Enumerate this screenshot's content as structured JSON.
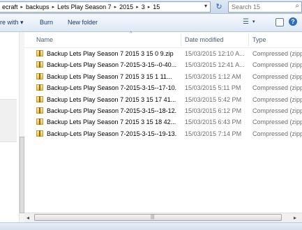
{
  "address": {
    "crumbs": [
      "ecraft",
      "backups",
      "Lets Play Season 7",
      "2015",
      "3",
      "15"
    ],
    "separator": "▸",
    "dropdown_glyph": "▾",
    "refresh_glyph": "↻"
  },
  "search": {
    "placeholder": "Search 15",
    "icon": "magnifier-icon"
  },
  "toolbar": {
    "share_label": "re with",
    "share_dd": "▾",
    "burn_label": "Burn",
    "newfolder_label": "New folder",
    "help_label": "?"
  },
  "columns": {
    "name": "Name",
    "date": "Date modified",
    "type": "Type",
    "sort_glyph": "^"
  },
  "files": [
    {
      "name": "Backup Lets Play Season 7 2015 3 15 0 9.zip",
      "date": "15/03/2015 12:10 A...",
      "type": "Compressed (zipp..."
    },
    {
      "name": "Backup-Lets Play Season 7-2015-3-15--0-40...",
      "date": "15/03/2015 12:41 A...",
      "type": "Compressed (zipp..."
    },
    {
      "name": "Backup Lets Play Season 7 2015 3 15 1 11...",
      "date": "15/03/2015 1:12 AM",
      "type": "Compressed (zipp..."
    },
    {
      "name": "Backup-Lets Play Season 7-2015-3-15--17-10...",
      "date": "15/03/2015 5:11 PM",
      "type": "Compressed (zipp..."
    },
    {
      "name": "Backup Lets Play Season 7 2015 3 15 17 41...",
      "date": "15/03/2015 5:42 PM",
      "type": "Compressed (zipp..."
    },
    {
      "name": "Backup-Lets Play Season 7-2015-3-15--18-12...",
      "date": "15/03/2015 6:12 PM",
      "type": "Compressed (zipp..."
    },
    {
      "name": "Backup Lets Play Season 7 2015 3 15 18 42...",
      "date": "15/03/2015 6:43 PM",
      "type": "Compressed (zipp..."
    },
    {
      "name": "Backup-Lets Play Season 7-2015-3-15--19-13...",
      "date": "15/03/2015 7:14 PM",
      "type": "Compressed (zipp..."
    }
  ],
  "hscroll": {
    "left": "◂",
    "right": "▸",
    "grip": "|||"
  }
}
